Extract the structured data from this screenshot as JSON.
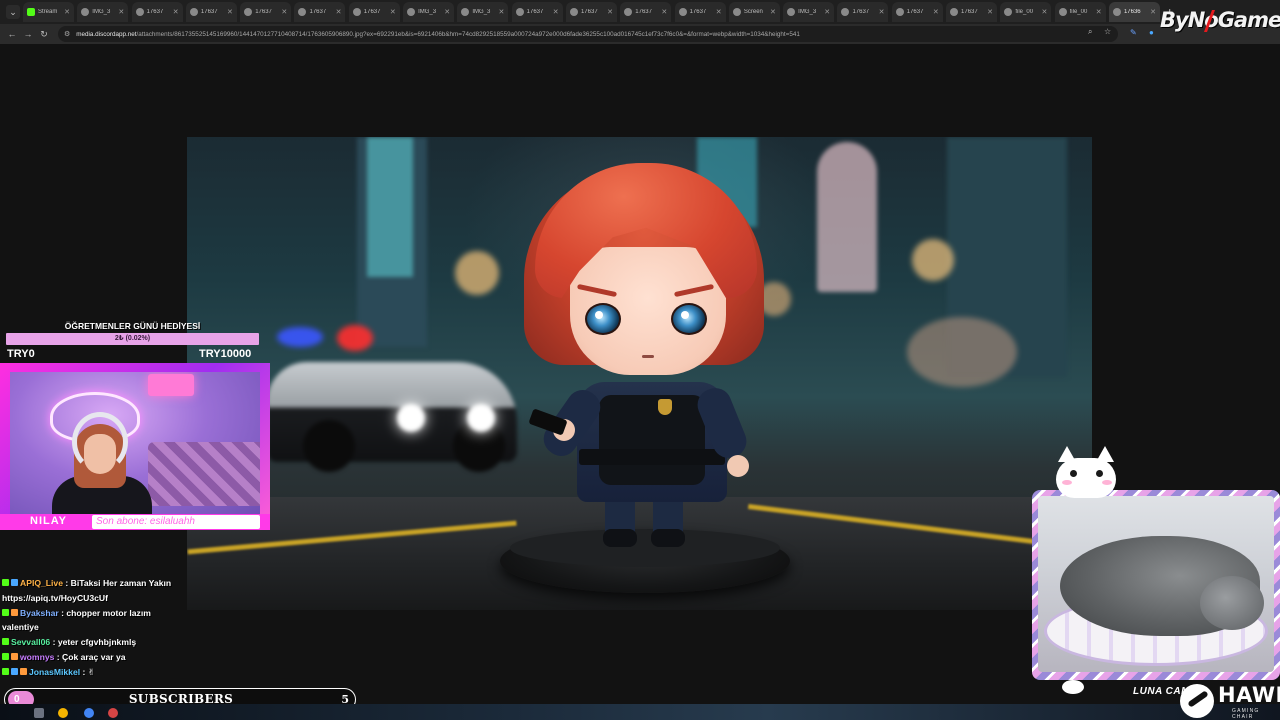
{
  "browser": {
    "tabs": [
      {
        "label": "Stream",
        "favicon": "kick"
      },
      {
        "label": "IMG_3",
        "favicon": "globe"
      },
      {
        "label": "17637",
        "favicon": "globe"
      },
      {
        "label": "17637",
        "favicon": "globe"
      },
      {
        "label": "17637",
        "favicon": "globe"
      },
      {
        "label": "17637",
        "favicon": "globe"
      },
      {
        "label": "17637",
        "favicon": "globe"
      },
      {
        "label": "IMG_3",
        "favicon": "globe"
      },
      {
        "label": "IMG_3",
        "favicon": "globe"
      },
      {
        "label": "17637",
        "favicon": "globe"
      },
      {
        "label": "17637",
        "favicon": "globe"
      },
      {
        "label": "17637",
        "favicon": "globe"
      },
      {
        "label": "17637",
        "favicon": "globe"
      },
      {
        "label": "Screen",
        "favicon": "globe"
      },
      {
        "label": "IMG_3",
        "favicon": "globe"
      },
      {
        "label": "17637",
        "favicon": "globe"
      },
      {
        "label": "17637",
        "favicon": "globe"
      },
      {
        "label": "17637",
        "favicon": "globe"
      },
      {
        "label": "file_00",
        "favicon": "globe"
      },
      {
        "label": "file_00",
        "favicon": "globe"
      },
      {
        "label": "17636",
        "favicon": "globe",
        "active": true
      }
    ],
    "url_host": "media.discordapp.net",
    "url_path": "/attachments/861735525145169960/1441470127710408714/1763605906890.jpg?ex=692291eb&is=6921406b&hm=74cd8292518559a000724a972e000d6fade36255c100ad016745c1ef73c7f6c0&=&format=webp&width=1034&height=541"
  },
  "watermark": {
    "brand": "ByNoGame",
    "accent": "#e5191d"
  },
  "goal": {
    "title": "ÖĞRETMENLER GÜNÜ HEDİYESİ",
    "progress_label": "2₺ (0.02%)",
    "progress": 0.0002,
    "min_label": "TRY0",
    "max_label": "TRY10000",
    "bar_color": "#e7a3e8"
  },
  "webcam": {
    "streamer_name": "NILAY",
    "last_sub_text": "Son abone: esilaluahh",
    "frame_color": "#ff3ae8"
  },
  "chat": [
    {
      "user": "APIQ_Live",
      "user_color": "#ffb347",
      "badges": [
        "#53fc18",
        "#4aa8ff"
      ],
      "text": " : BiTaksi Her zaman Yakın https://apiq.tv/HoyCU3cUf"
    },
    {
      "user": "Byakshar",
      "user_color": "#7fb0ff",
      "badges": [
        "#53fc18",
        "#ff9a3c"
      ],
      "text": " : chopper motor lazım valentiye"
    },
    {
      "user": "Sevvall06",
      "user_color": "#58f0a0",
      "badges": [
        "#53fc18"
      ],
      "text": " : yeter cfgvhbjnkmlş"
    },
    {
      "user": "womnys",
      "user_color": "#c77dff",
      "badges": [
        "#53fc18",
        "#ff9a3c"
      ],
      "text": " : Çok araç var ya"
    },
    {
      "user": "JonasMikkel",
      "user_color": "#5cc8ff",
      "badges": [
        "#53fc18",
        "#4aa8ff",
        "#ff9a3c"
      ],
      "text": " : ✌"
    }
  ],
  "subscribers": {
    "label": "SUBSCRIBERS",
    "current": "0",
    "target": "5",
    "progress": 0
  },
  "petcam": {
    "label": "LUNA CAM"
  },
  "sponsor": {
    "name": "HAWK",
    "tagline": "GAMING CHAIR"
  }
}
